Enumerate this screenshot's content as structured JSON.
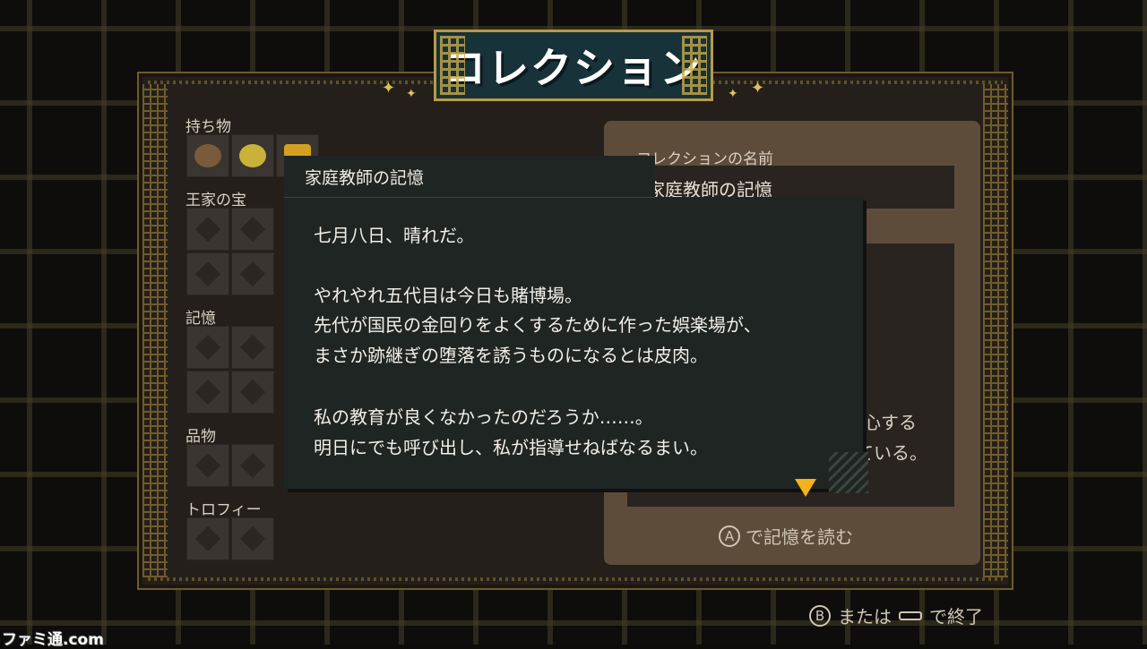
{
  "screen_title": "コレクション",
  "categories": [
    {
      "label": "持ち物",
      "id": "belongings"
    },
    {
      "label": "王家の宝",
      "id": "royal-treasure"
    },
    {
      "label": "記憶",
      "id": "memories"
    },
    {
      "label": "品物",
      "id": "goods"
    },
    {
      "label": "トロフィー",
      "id": "trophies"
    }
  ],
  "info_panel": {
    "name_label": "コレクションの名前",
    "name_value": "家庭教師の記憶",
    "desc_partial": [
      "心する",
      "ている。"
    ],
    "read_hint_button": "A",
    "read_hint_text": "で記憶を読む"
  },
  "popup": {
    "title": "家庭教師の記憶",
    "lines": [
      "七月八日、晴れだ。",
      "",
      "やれやれ五代目は今日も賭博場。",
      "先代が国民の金回りをよくするために作った娯楽場が、",
      "まさか跡継ぎの堕落を誘うものになるとは皮肉。",
      "",
      "私の教育が良くなかったのだろうか……。",
      "明日にでも呼び出し、私が指導せねばなるまい。"
    ],
    "continue_icon": "down-arrow-icon"
  },
  "footer": {
    "button_b": "B",
    "text_or": "または",
    "text_end": "で終了"
  },
  "watermark": "ファミ通.com",
  "colors": {
    "accent_arrow": "#f5b21a",
    "panel_gold": "#b89a45",
    "title_plate": "#18323a"
  }
}
